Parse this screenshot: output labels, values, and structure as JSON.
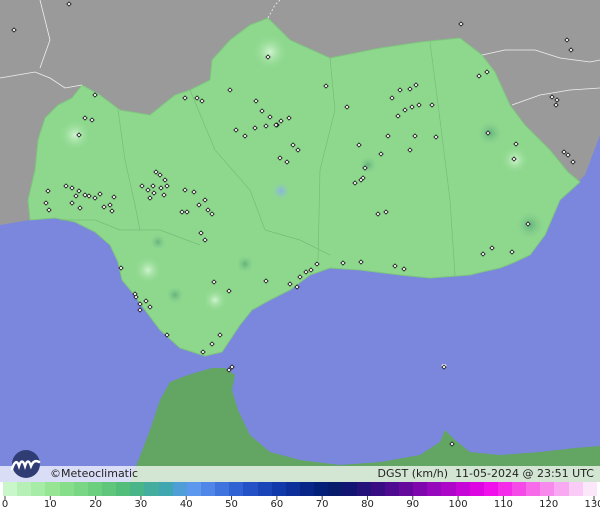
{
  "map": {
    "sea_color": "#7a87dd",
    "land_color_andalucia": "#8ed88e",
    "land_color_other": "#9a9a9a",
    "land_color_africa": "#63a563"
  },
  "footer": {
    "brand": "Meteoclimatic",
    "copyright_symbol": "©",
    "metric": "DGST (km/h)",
    "timestamp": "11-05-2024 @ 23:51 UTC"
  },
  "legend": {
    "colors": [
      "#c9f7c9",
      "#b7f0b7",
      "#a6eba6",
      "#95e595",
      "#86de8a",
      "#79d684",
      "#6ccf80",
      "#5fc67b",
      "#52be79",
      "#4bb58a",
      "#45ad9d",
      "#40a6b0",
      "#4f9ed8",
      "#5c98ee",
      "#4f86e8",
      "#3f74df",
      "#3162d4",
      "#2452c6",
      "#1a45b8",
      "#1239a9",
      "#0c2f99",
      "#072688",
      "#041f78",
      "#071b6c",
      "#111571",
      "#241179",
      "#380d84",
      "#4e0a90",
      "#660a9e",
      "#7e08ad",
      "#9608bc",
      "#ad06c9",
      "#c506d6",
      "#dd06e3",
      "#ef10ec",
      "#f42ce9",
      "#f64ae8",
      "#f76ae9",
      "#f889ed",
      "#f9a9f1",
      "#facbf6",
      "#fbe6fa"
    ],
    "labels": [
      "0",
      "10",
      "20",
      "30",
      "40",
      "50",
      "60",
      "70",
      "80",
      "90",
      "100",
      "110",
      "120",
      "130"
    ]
  },
  "stations": [
    [
      14,
      30
    ],
    [
      69,
      4
    ],
    [
      95,
      95
    ],
    [
      85,
      118
    ],
    [
      92,
      120
    ],
    [
      79,
      135
    ],
    [
      66,
      186
    ],
    [
      72,
      188
    ],
    [
      79,
      191
    ],
    [
      85,
      195
    ],
    [
      89,
      196
    ],
    [
      95,
      198
    ],
    [
      100,
      194
    ],
    [
      114,
      197
    ],
    [
      110,
      205
    ],
    [
      104,
      207
    ],
    [
      76,
      196
    ],
    [
      72,
      203
    ],
    [
      80,
      208
    ],
    [
      46,
      203
    ],
    [
      49,
      210
    ],
    [
      48,
      191
    ],
    [
      112,
      211
    ],
    [
      142,
      186
    ],
    [
      148,
      190
    ],
    [
      153,
      186
    ],
    [
      154,
      193
    ],
    [
      161,
      188
    ],
    [
      165,
      180
    ],
    [
      167,
      186
    ],
    [
      156,
      172
    ],
    [
      160,
      175
    ],
    [
      150,
      198
    ],
    [
      164,
      195
    ],
    [
      185,
      190
    ],
    [
      194,
      192
    ],
    [
      199,
      205
    ],
    [
      205,
      200
    ],
    [
      208,
      210
    ],
    [
      212,
      214
    ],
    [
      182,
      212
    ],
    [
      187,
      212
    ],
    [
      201,
      233
    ],
    [
      205,
      240
    ],
    [
      185,
      98
    ],
    [
      197,
      98
    ],
    [
      202,
      101
    ],
    [
      230,
      90
    ],
    [
      256,
      101
    ],
    [
      262,
      111
    ],
    [
      270,
      117
    ],
    [
      277,
      125
    ],
    [
      266,
      126
    ],
    [
      255,
      128
    ],
    [
      245,
      136
    ],
    [
      236,
      130
    ],
    [
      276,
      125
    ],
    [
      281,
      121
    ],
    [
      289,
      118
    ],
    [
      293,
      145
    ],
    [
      280,
      158
    ],
    [
      287,
      162
    ],
    [
      298,
      150
    ],
    [
      268,
      57
    ],
    [
      326,
      86
    ],
    [
      347,
      107
    ],
    [
      359,
      145
    ],
    [
      363,
      178
    ],
    [
      361,
      180
    ],
    [
      355,
      183
    ],
    [
      365,
      168
    ],
    [
      381,
      154
    ],
    [
      388,
      136
    ],
    [
      392,
      98
    ],
    [
      400,
      90
    ],
    [
      410,
      89
    ],
    [
      416,
      85
    ],
    [
      412,
      107
    ],
    [
      419,
      105
    ],
    [
      405,
      110
    ],
    [
      398,
      116
    ],
    [
      410,
      150
    ],
    [
      415,
      136
    ],
    [
      432,
      105
    ],
    [
      436,
      137
    ],
    [
      479,
      76
    ],
    [
      487,
      72
    ],
    [
      488,
      133
    ],
    [
      514,
      159
    ],
    [
      516,
      144
    ],
    [
      378,
      214
    ],
    [
      386,
      212
    ],
    [
      343,
      263
    ],
    [
      361,
      262
    ],
    [
      395,
      266
    ],
    [
      404,
      269
    ],
    [
      483,
      254
    ],
    [
      492,
      248
    ],
    [
      512,
      252
    ],
    [
      528,
      224
    ],
    [
      317,
      264
    ],
    [
      311,
      270
    ],
    [
      306,
      272
    ],
    [
      300,
      277
    ],
    [
      297,
      287
    ],
    [
      290,
      284
    ],
    [
      266,
      281
    ],
    [
      229,
      291
    ],
    [
      214,
      282
    ],
    [
      220,
      335
    ],
    [
      212,
      344
    ],
    [
      203,
      352
    ],
    [
      167,
      335
    ],
    [
      146,
      301
    ],
    [
      150,
      307
    ],
    [
      140,
      304
    ],
    [
      136,
      297
    ],
    [
      140,
      310
    ],
    [
      135,
      294
    ],
    [
      121,
      268
    ],
    [
      461,
      24
    ],
    [
      567,
      40
    ],
    [
      571,
      50
    ],
    [
      552,
      97
    ],
    [
      557,
      100
    ],
    [
      556,
      105
    ],
    [
      564,
      152
    ],
    [
      568,
      155
    ],
    [
      573,
      162
    ],
    [
      444,
      367
    ],
    [
      452,
      444
    ],
    [
      232,
      367
    ],
    [
      229,
      370
    ]
  ]
}
